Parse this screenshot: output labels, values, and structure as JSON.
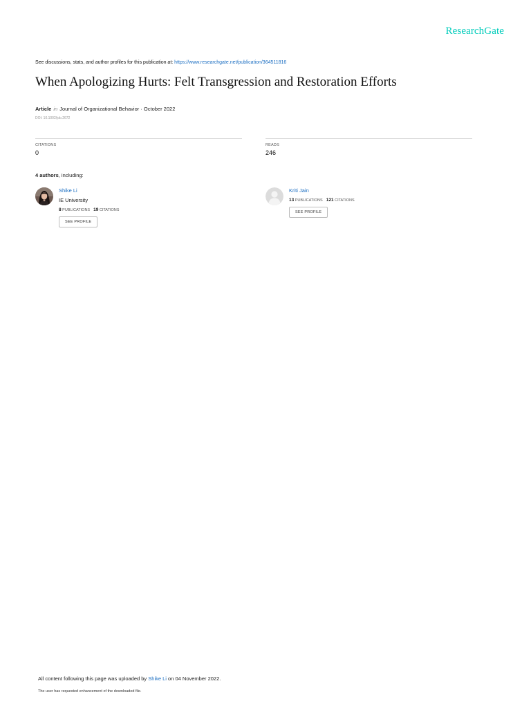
{
  "brand": {
    "logo": "ResearchGate"
  },
  "header": {
    "discuss_text": "See discussions, stats, and author profiles for this publication at: ",
    "publication_link": "https://www.researchgate.net/publication/364511816"
  },
  "publication": {
    "title": "When Apologizing Hurts: Felt Transgression and Restoration Efforts",
    "type": "Article",
    "in_label": "in",
    "journal_date": "Journal of Organizational Behavior · October 2022",
    "doi": "DOI: 10.1002/job.2672"
  },
  "stats": {
    "citations_label": "CITATIONS",
    "citations_value": "0",
    "reads_label": "READS",
    "reads_value": "246"
  },
  "authors_section": {
    "count_text": "4 authors",
    "suffix": ", including:"
  },
  "authors": [
    {
      "name": "Shike Li",
      "institution": "IE University",
      "publications": "8",
      "publications_label": "PUBLICATIONS",
      "citations": "19",
      "citations_label": "CITATIONS",
      "button": "SEE PROFILE"
    },
    {
      "name": "Kriti Jain",
      "institution": "",
      "publications": "13",
      "publications_label": "PUBLICATIONS",
      "citations": "121",
      "citations_label": "CITATIONS",
      "button": "SEE PROFILE"
    }
  ],
  "footer": {
    "upload_prefix": "All content following this page was uploaded by ",
    "uploader": "Shike Li",
    "upload_suffix": " on 04 November 2022.",
    "note": "The user has requested enhancement of the downloaded file."
  },
  "colors": {
    "brand": "#00ccbb",
    "link": "#1b6ec2"
  }
}
